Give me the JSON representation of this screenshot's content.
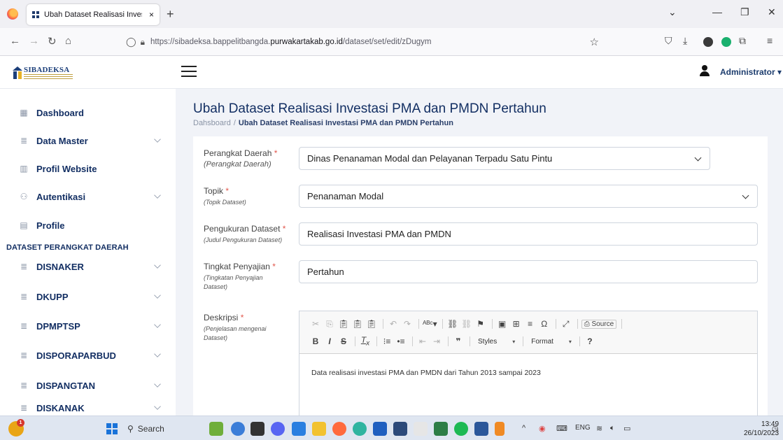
{
  "browser": {
    "tab_title": "Ubah Dataset Realisasi Investasi",
    "tab_close": "×",
    "new_tab": "+",
    "url_host_prefix": "https://sibadeksa.bappelitbangda.",
    "url_host_domain": "purwakartakab.go.id",
    "url_path": "/dataset/set/edit/zDugym"
  },
  "app": {
    "logo_text": "SIBADEKSA",
    "user_name": "Administrator ▾"
  },
  "sidebar": {
    "items": [
      {
        "label": "Dashboard",
        "icon": "grid-icon",
        "glyph": "▦",
        "caret": false
      },
      {
        "label": "Data Master",
        "icon": "database-icon",
        "glyph": "≣",
        "caret": true
      },
      {
        "label": "Profil Website",
        "icon": "building-icon",
        "glyph": "▥",
        "caret": false
      },
      {
        "label": "Autentikasi",
        "icon": "users-icon",
        "glyph": "⚇",
        "caret": true
      },
      {
        "label": "Profile",
        "icon": "id-card-icon",
        "glyph": "▤",
        "caret": false
      }
    ],
    "section_heading": "DATASET PERANGKAT DAERAH",
    "dataset_items": [
      {
        "label": "DISNAKER",
        "icon": "database-icon",
        "glyph": "≣"
      },
      {
        "label": "DKUPP",
        "icon": "database-icon",
        "glyph": "≣"
      },
      {
        "label": "DPMPTSP",
        "icon": "database-icon",
        "glyph": "≣"
      },
      {
        "label": "DISPORAPARBUD",
        "icon": "database-icon",
        "glyph": "≣"
      },
      {
        "label": "DISPANGTAN",
        "icon": "database-icon",
        "glyph": "≣"
      },
      {
        "label": "DISKANAK",
        "icon": "database-icon",
        "glyph": "≣"
      }
    ]
  },
  "page": {
    "title": "Ubah Dataset Realisasi Investasi PMA dan PMDN Pertahun",
    "breadcrumb_home": "Dahsboard",
    "breadcrumb_sep": "/",
    "breadcrumb_current": "Ubah Dataset Realisasi Investasi PMA dan PMDN Pertahun"
  },
  "form": {
    "required_mark": "*",
    "perangkat": {
      "label": "Perangkat Daerah",
      "hint": "(Perangkat Daerah)",
      "value": "Dinas Penanaman Modal dan Pelayanan Terpadu Satu Pintu"
    },
    "topik": {
      "label": "Topik",
      "hint": "(Topik Dataset)",
      "value": "Penanaman Modal"
    },
    "pengukuran": {
      "label": "Pengukuran Dataset",
      "hint": "(Judul Pengukuran Dataset)",
      "value": "Realisasi Investasi PMA dan PMDN"
    },
    "tingkat": {
      "label": "Tingkat Penyajian",
      "hint": "(Tingkatan Penyajian Dataset)",
      "value": "Pertahun"
    },
    "deskripsi": {
      "label": "Deskripsi",
      "hint": "(Penjelasan mengenai Dataset)",
      "value": "Data realisasi investasi PMA dan PMDN dari Tahun 2013 sampai 2023"
    }
  },
  "editor": {
    "source_label": "Source",
    "styles_label": "Styles",
    "format_label": "Format",
    "help_label": "?"
  },
  "taskbar": {
    "search_label": "Search",
    "badge": "1",
    "lang": "ENG",
    "time": "13:49",
    "date": "26/10/2023"
  }
}
